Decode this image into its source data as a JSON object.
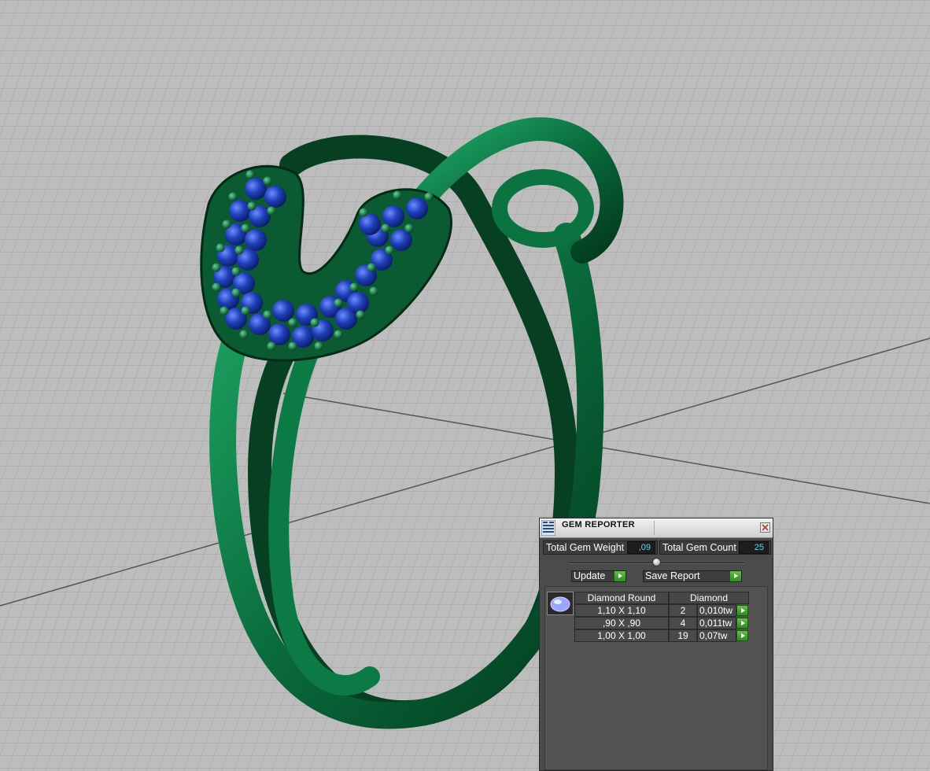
{
  "panel": {
    "title": "GEM REPORTER",
    "total_gem_weight_label": "Total Gem Weight",
    "total_gem_weight_value": ",09",
    "total_gem_count_label": "Total Gem Count",
    "total_gem_count_value": "25",
    "update_label": "Update",
    "save_report_label": "Save Report"
  },
  "gem_table": {
    "shape_header": "Diamond Round",
    "material_header": "Diamond",
    "rows": [
      {
        "size": "1,10 X 1,10",
        "count": "2",
        "weight": "0,010tw"
      },
      {
        "size": ",90 X ,90",
        "count": "4",
        "weight": "0,011tw"
      },
      {
        "size": "1,00 X 1,00",
        "count": "19",
        "weight": "0,07tw"
      }
    ]
  },
  "colors": {
    "metal": "#0a6b3c",
    "gem": "#1a3fb0",
    "value_text": "#5fd4ff",
    "button_go": "#3fa52a"
  },
  "icons": [
    "gem-reporter-icon",
    "close-icon",
    "play-arrow-icon",
    "oval-gem-icon"
  ]
}
